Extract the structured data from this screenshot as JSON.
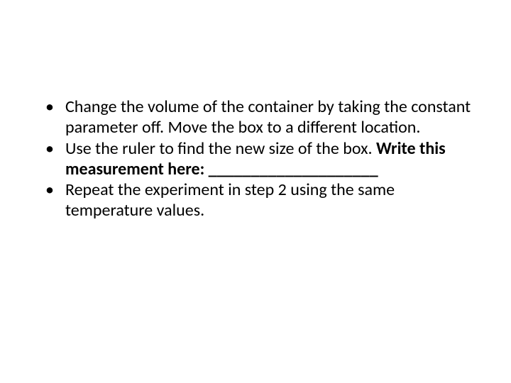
{
  "bullets": [
    {
      "pre": "Change the volume of the container by taking the constant parameter off. Move the box to a different location."
    },
    {
      "pre": "Use the ruler to find the new size of the box. ",
      "bold": "Write this measurement here: ____________________"
    },
    {
      "pre": "Repeat the experiment in step 2 using the same temperature values."
    }
  ]
}
